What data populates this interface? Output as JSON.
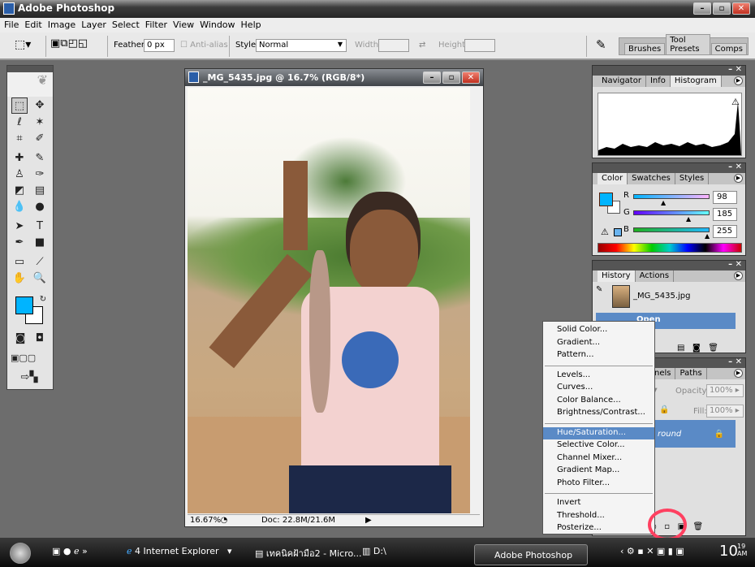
{
  "app": {
    "title": "Adobe Photoshop"
  },
  "menu": [
    "File",
    "Edit",
    "Image",
    "Layer",
    "Select",
    "Filter",
    "View",
    "Window",
    "Help"
  ],
  "options": {
    "feather_label": "Feather:",
    "feather_value": "0 px",
    "antialias_label": "Anti-alias",
    "style_label": "Style:",
    "style_value": "Normal",
    "width_label": "Width:",
    "height_label": "Height:"
  },
  "wells": [
    "Brushes",
    "Tool Presets",
    "Comps"
  ],
  "document": {
    "title": "_MG_5435.jpg @ 16.7% (RGB/8*)",
    "zoom": "16.67%",
    "doc_size": "Doc: 22.8M/21.6M"
  },
  "navigator_panel": {
    "tabs": [
      "Navigator",
      "Info",
      "Histogram"
    ],
    "active": "Histogram"
  },
  "color_panel": {
    "tabs": [
      "Color",
      "Swatches",
      "Styles"
    ],
    "channels": [
      {
        "label": "R",
        "value": "98"
      },
      {
        "label": "G",
        "value": "185"
      },
      {
        "label": "B",
        "value": "255"
      }
    ],
    "foreground": "#00b4ff"
  },
  "history_panel": {
    "tabs": [
      "History",
      "Actions"
    ],
    "snapshot": "_MG_5435.jpg",
    "items": [
      "Open"
    ]
  },
  "layers_panel": {
    "tabs": [
      "Channels",
      "Paths"
    ],
    "visible_tab_fragment": "nels",
    "opacity_label": "Opacity:",
    "opacity": "100%",
    "fill_label": "Fill:",
    "fill": "100%",
    "layer": "Background",
    "layer_fragment": "round"
  },
  "adjustment_menu": {
    "groups": [
      [
        "Solid Color...",
        "Gradient...",
        "Pattern..."
      ],
      [
        "Levels...",
        "Curves...",
        "Color Balance...",
        "Brightness/Contrast..."
      ],
      [
        "Hue/Saturation...",
        "Selective Color...",
        "Channel Mixer...",
        "Gradient Map...",
        "Photo Filter..."
      ],
      [
        "Invert",
        "Threshold...",
        "Posterize..."
      ]
    ],
    "highlighted": "Hue/Saturation..."
  },
  "taskbar": {
    "ie": "4 Internet Explorer",
    "word": "เทคนิคฝ้ามือ2 - Micro...",
    "explorer": "D:\\",
    "photoshop": "Adobe Photoshop",
    "clock": "10",
    "clock_small": "19",
    "ampm": "AM"
  }
}
